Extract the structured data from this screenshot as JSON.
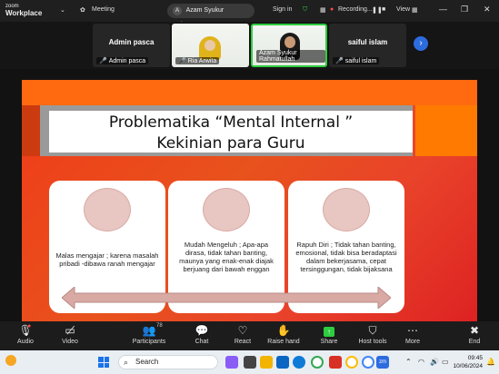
{
  "app": {
    "logo_top": "zoom",
    "logo_bottom": "Workplace",
    "meeting_label": "Meeting"
  },
  "header": {
    "speaker_pill": "Azam Syukur Rahmatu",
    "speaker_initial": "A",
    "signin": "Sign in",
    "recording": "Recording...",
    "view": "View"
  },
  "participants": [
    {
      "name_big": "Admin pasca",
      "label": "Admin pasca"
    },
    {
      "label": "Ria Arwita"
    },
    {
      "label": "Azam Syukur Rahmatullah"
    },
    {
      "name_big": "saiful islam",
      "label": "saiful islam"
    }
  ],
  "slide": {
    "title_line1": "Problematika “Mental Internal ”",
    "title_line2": "Kekinian para Guru",
    "cards": [
      "Malas mengajar ; karena masalah pribadi -dibawa ranah mengajar",
      "Mudah Mengeluh ; Apa-apa dirasa, tidak tahan banting, maunya yang enak-enak diajak berjuang dari bawah enggan",
      "Rapuh Diri ; Tidak tahan banting, emosional, tidak bisa beradaptasi dalam bekerjasama, cepat tersinggungan, tidak bijaksana"
    ]
  },
  "toolbar": {
    "audio": "Audio",
    "video": "Video",
    "participants": "Participants",
    "participants_count": "78",
    "chat": "Chat",
    "react": "React",
    "raise_hand": "Raise hand",
    "share": "Share",
    "host_tools": "Host tools",
    "more": "More",
    "end": "End"
  },
  "taskbar": {
    "search": "Search",
    "time": "09:45",
    "date": "10/06/2024"
  }
}
